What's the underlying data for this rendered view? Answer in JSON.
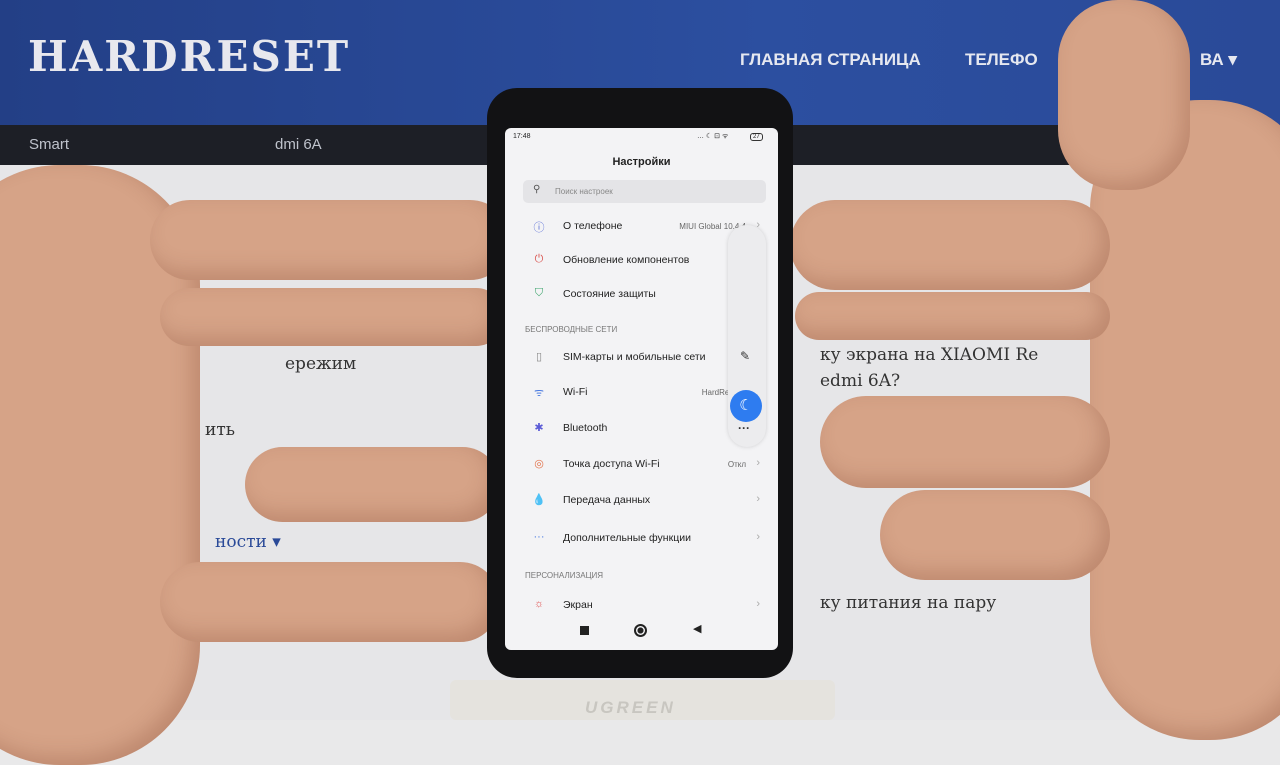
{
  "website": {
    "logo": "HARDRESET",
    "nav": [
      "ГЛАВНАЯ СТРАНИЦА",
      "ТЕЛЕФО",
      "ВА ▾"
    ],
    "breadcrumb": [
      "Smart",
      "dmi 6A"
    ],
    "fragments": [
      "ку экрана на XIAOMI Re",
      "edmi 6A?",
      "ку питания на пару",
      "ности ▾",
      "ить",
      "ережим"
    ]
  },
  "phone": {
    "status": {
      "time": "17:48",
      "icons": "… ☾ ⊡ ᯤ",
      "battery": "27"
    },
    "title": "Настройки",
    "search_placeholder": "Поиск настроек",
    "rows1": [
      {
        "icon": "info-icon",
        "glyph": "ⓘ",
        "color": "#5b6fd6",
        "label": "О телефоне",
        "value": "MIUI Global 10.4.4"
      },
      {
        "icon": "update-icon",
        "glyph": "⏻",
        "color": "#d9534f",
        "label": "Обновление компонентов",
        "value": ""
      },
      {
        "icon": "shield-icon",
        "glyph": "⛉",
        "color": "#3aa36a",
        "label": "Состояние защиты",
        "value": ""
      }
    ],
    "section_wireless": "БЕСПРОВОДНЫЕ СЕТИ",
    "rows2": [
      {
        "icon": "sim-icon",
        "glyph": "▯",
        "color": "#888",
        "label": "SIM-карты и мобильные сети",
        "value": ""
      },
      {
        "icon": "wifi-icon",
        "glyph": "ᯤ",
        "color": "#4a7be0",
        "label": "Wi-Fi",
        "value": "HardReset.i"
      },
      {
        "icon": "bluetooth-icon",
        "glyph": "✱",
        "color": "#5a5ad6",
        "label": "Bluetooth",
        "value": "O"
      },
      {
        "icon": "hotspot-icon",
        "glyph": "◎",
        "color": "#e2724a",
        "label": "Точка доступа Wi-Fi",
        "value": "Откл"
      },
      {
        "icon": "data-icon",
        "glyph": "💧",
        "color": "#4a7be0",
        "label": "Передача данных",
        "value": ""
      },
      {
        "icon": "more-icon",
        "glyph": "···",
        "color": "#4a7be0",
        "label": "Дополнительные функции",
        "value": ""
      }
    ],
    "section_personal": "ПЕРСОНАЛИЗАЦИЯ",
    "rows3": [
      {
        "icon": "display-icon",
        "glyph": "☼",
        "color": "#e05050",
        "label": "Экран",
        "value": ""
      }
    ],
    "accent": "#2e7cf0"
  },
  "stand_logo": "UGREEN"
}
